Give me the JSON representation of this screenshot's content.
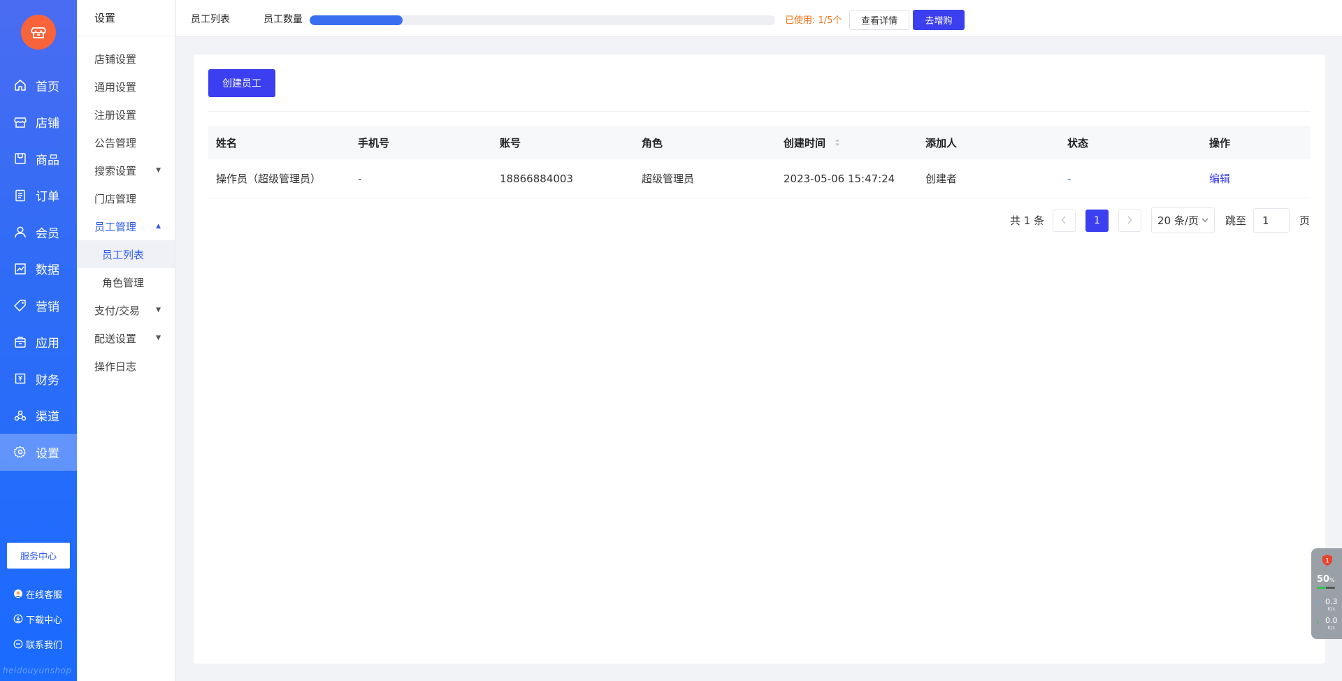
{
  "nav": {
    "items": [
      {
        "label": "首页",
        "icon": "home-icon"
      },
      {
        "label": "店铺",
        "icon": "store-icon"
      },
      {
        "label": "商品",
        "icon": "goods-icon"
      },
      {
        "label": "订单",
        "icon": "order-icon"
      },
      {
        "label": "会员",
        "icon": "member-icon"
      },
      {
        "label": "数据",
        "icon": "chart-icon"
      },
      {
        "label": "营销",
        "icon": "tag-icon"
      },
      {
        "label": "应用",
        "icon": "app-icon"
      },
      {
        "label": "财务",
        "icon": "finance-icon"
      },
      {
        "label": "渠道",
        "icon": "channel-icon"
      },
      {
        "label": "设置",
        "icon": "gear-icon"
      }
    ],
    "active_index": 10,
    "service_center": "服务中心",
    "bottom_links": [
      {
        "label": "在线客服",
        "icon": "customer-service-icon"
      },
      {
        "label": "下载中心",
        "icon": "download-icon"
      },
      {
        "label": "联系我们",
        "icon": "chat-icon"
      }
    ],
    "watermark": "heidouyunshop"
  },
  "secondary_nav": {
    "title": "设置",
    "items": [
      {
        "label": "店铺设置"
      },
      {
        "label": "通用设置"
      },
      {
        "label": "注册设置"
      },
      {
        "label": "公告管理"
      },
      {
        "label": "搜索设置",
        "has_arrow": true
      },
      {
        "label": "门店管理"
      },
      {
        "label": "员工管理",
        "open": true,
        "children": [
          "员工列表",
          "角色管理"
        ]
      },
      {
        "label": "支付/交易",
        "has_arrow": true
      },
      {
        "label": "配送设置",
        "has_arrow": true
      },
      {
        "label": "操作日志"
      }
    ],
    "active_child": "员工列表"
  },
  "topbar": {
    "page_title": "员工列表",
    "quota_label": "员工数量",
    "quota_used": 1,
    "quota_total": 5,
    "used_text": "已使用: 1/5个",
    "detail_btn": "查看详情",
    "buy_btn": "去增购",
    "accent_color": "#3b3ff0",
    "warn_color": "#f3741a"
  },
  "main": {
    "create_btn": "创建员工",
    "table": {
      "headers": [
        "姓名",
        "手机号",
        "账号",
        "角色",
        "创建时间",
        "添加人",
        "状态",
        "操作"
      ],
      "sortable_column": 4,
      "rows": [
        [
          "操作员（超级管理员）",
          "-",
          "18866884003",
          "超级管理员",
          "2023-05-06 15:47:24",
          "创建者",
          "-",
          "编辑"
        ]
      ]
    },
    "pagination": {
      "total_text": "共 1 条",
      "current_page": "1",
      "page_size": "20 条/页",
      "jump_label": "跳至",
      "jump_value": "1",
      "page_suffix": "页"
    }
  },
  "float_widget": {
    "badge": "1",
    "percent": "50",
    "percent_unit": "%",
    "percent_value": 0.5,
    "up_speed": "0.3",
    "down_speed": "0.0",
    "speed_unit": "K/s"
  }
}
